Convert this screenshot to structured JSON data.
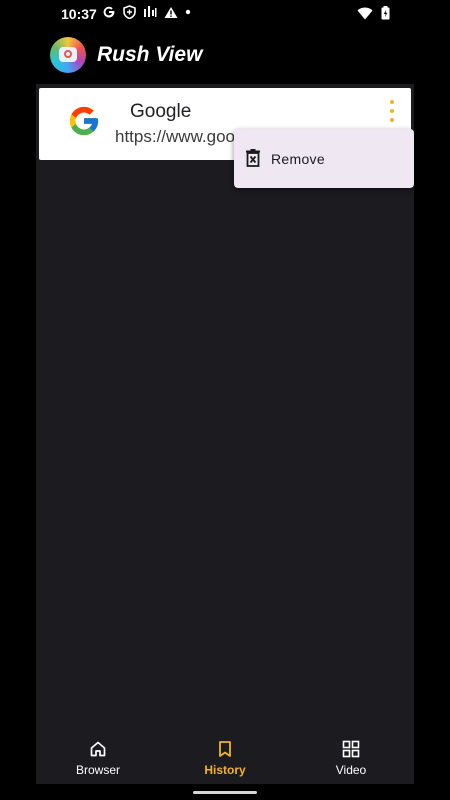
{
  "status_bar": {
    "time": "10:37",
    "left_icons": [
      "google-g-icon",
      "shield-icon",
      "signal-bars-icon",
      "warning-icon",
      "dot-icon"
    ],
    "right_icons": [
      "wifi-icon",
      "battery-icon"
    ]
  },
  "app_bar": {
    "title": "Rush View",
    "logo": "app-logo-icon"
  },
  "history": {
    "items": [
      {
        "title": "Google",
        "url": "https://www.goo",
        "icon": "google-icon"
      }
    ]
  },
  "popup_menu": {
    "items": [
      {
        "label": "Remove",
        "icon": "remove-icon"
      }
    ]
  },
  "bottom_nav": {
    "items": [
      {
        "label": "Browser",
        "icon": "home-icon"
      },
      {
        "label": "History",
        "icon": "bookmark-icon"
      },
      {
        "label": "Video",
        "icon": "grid-icon"
      }
    ],
    "active": "History"
  },
  "colors": {
    "accent": "#f0b429",
    "background": "#1c1b20",
    "menu_background": "#efe8f3"
  }
}
